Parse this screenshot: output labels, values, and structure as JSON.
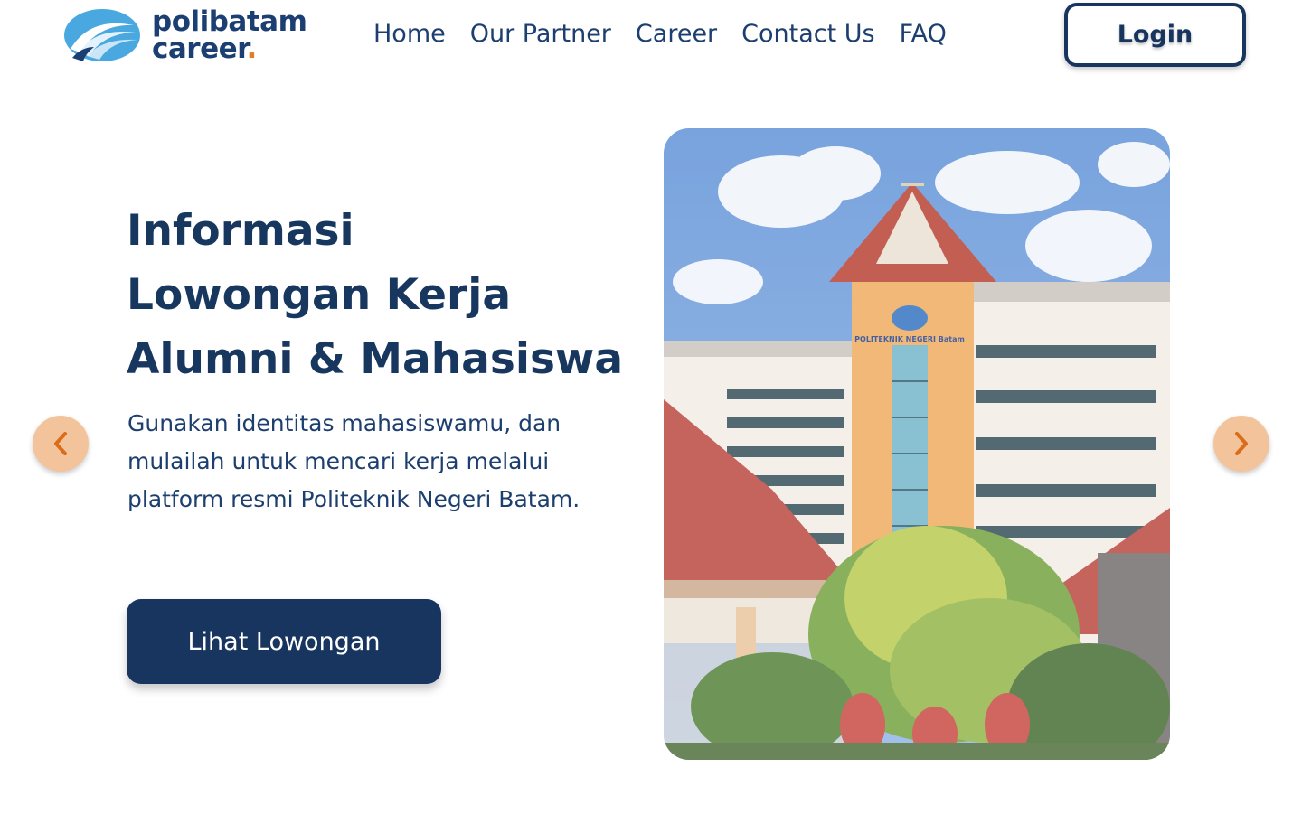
{
  "header": {
    "logo": {
      "line1": "polibatam",
      "line2": "career",
      "dot": "."
    },
    "nav": [
      {
        "label": "Home"
      },
      {
        "label": "Our Partner"
      },
      {
        "label": "Career"
      },
      {
        "label": "Contact Us"
      },
      {
        "label": "FAQ"
      }
    ],
    "login_label": "Login"
  },
  "hero": {
    "title_lines": [
      "Informasi",
      "Lowongan Kerja",
      "Alumni & Mahasiswa"
    ],
    "description": "Gunakan identitas mahasiswamu, dan mulailah untuk mencari kerja melalui platform resmi Politeknik Negeri Batam.",
    "cta_label": "Lihat Lowongan",
    "image_sign": "POLITEKNIK NEGERI Batam"
  },
  "carousel": {
    "prev_icon": "chevron-left-icon",
    "next_icon": "chevron-right-icon"
  },
  "colors": {
    "primary": "#17355f",
    "accent": "#e57b24",
    "arrow_bg": "#f3c49c",
    "logo_blue": "#4aa8e0"
  }
}
